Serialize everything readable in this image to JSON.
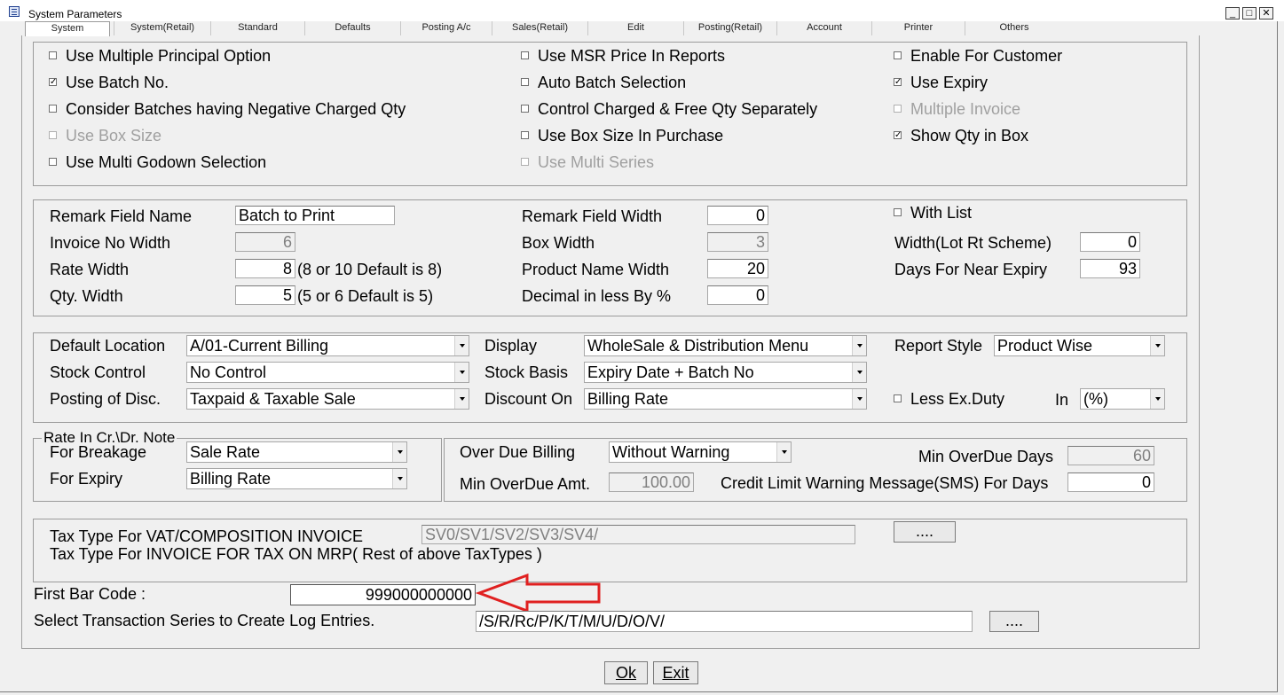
{
  "window": {
    "title": "System Parameters",
    "icon": "app-menu-icon"
  },
  "tabs": [
    {
      "label": "System",
      "active": true
    },
    {
      "label": "System(Retail)"
    },
    {
      "label": "Standard"
    },
    {
      "label": "Defaults"
    },
    {
      "label": "Posting A/c"
    },
    {
      "label": "Sales(Retail)"
    },
    {
      "label": "Edit"
    },
    {
      "label": "Posting(Retail)"
    },
    {
      "label": "Account"
    },
    {
      "label": "Printer"
    },
    {
      "label": "Others"
    }
  ],
  "options": [
    {
      "label": "Use Multiple Principal Option",
      "checked": false,
      "enabled": true
    },
    {
      "label": "Use Batch No.",
      "checked": true,
      "enabled": true
    },
    {
      "label": "Consider Batches having Negative Charged Qty",
      "checked": false,
      "enabled": true
    },
    {
      "label": "Use Box Size",
      "checked": false,
      "enabled": false
    },
    {
      "label": "Use Multi Godown Selection",
      "checked": false,
      "enabled": true
    },
    {
      "label": "Use MSR  Price In Reports",
      "checked": false,
      "enabled": true
    },
    {
      "label": "Auto Batch Selection",
      "checked": false,
      "enabled": true
    },
    {
      "label": "Control Charged & Free Qty Separately",
      "checked": false,
      "enabled": true
    },
    {
      "label": "Use Box Size In Purchase",
      "checked": false,
      "enabled": true
    },
    {
      "label": "Use Multi Series",
      "checked": false,
      "enabled": false
    },
    {
      "label": "Enable For Customer",
      "checked": false,
      "enabled": true
    },
    {
      "label": "Use Expiry",
      "checked": true,
      "enabled": true
    },
    {
      "label": "Multiple Invoice",
      "checked": false,
      "enabled": false
    },
    {
      "label": "Show Qty in Box",
      "checked": true,
      "enabled": true
    }
  ],
  "fields": {
    "remark_field_name": {
      "label": "Remark Field Name",
      "value": "Batch to Print"
    },
    "invoice_no_width": {
      "label": "Invoice No Width",
      "value": "6"
    },
    "rate_width": {
      "label": "Rate Width",
      "value": "8",
      "hint": "(8 or 10 Default is 8)"
    },
    "qty_width": {
      "label": "Qty. Width",
      "value": "5",
      "hint": "(5 or 6 Default is 5)"
    },
    "remark_field_width": {
      "label": "Remark Field Width",
      "value": "0"
    },
    "box_width": {
      "label": "Box Width",
      "value": "3"
    },
    "product_name_width": {
      "label": "Product Name Width",
      "value": "20"
    },
    "decimal_less": {
      "label": "Decimal in less By %",
      "value": "0"
    },
    "with_list": {
      "label": "With List",
      "checked": false
    },
    "lot_rt_scheme_width": {
      "label": "Width(Lot Rt Scheme)",
      "value": "0"
    },
    "days_near_expiry": {
      "label": "Days For Near Expiry",
      "value": "93"
    }
  },
  "combos": {
    "default_location": {
      "label": "Default Location",
      "value": "A/01-Current Billing"
    },
    "stock_control": {
      "label": "Stock Control",
      "value": "No Control"
    },
    "posting_disc": {
      "label": "Posting of Disc.",
      "value": "Taxpaid & Taxable Sale"
    },
    "display": {
      "label": "Display",
      "value": "WholeSale & Distribution Menu"
    },
    "stock_basis": {
      "label": "Stock Basis",
      "value": "Expiry Date + Batch No"
    },
    "discount_on": {
      "label": "Discount On",
      "value": "Billing Rate"
    },
    "report_style": {
      "label": "Report Style",
      "value": "Product Wise"
    },
    "less_ex_duty": {
      "label": "Less Ex.Duty",
      "checked": false
    },
    "in_unit": {
      "label": "In",
      "value": "(%)"
    }
  },
  "rate_note": {
    "legend": "Rate In Cr.\\Dr. Note",
    "breakage": {
      "label": "For Breakage",
      "value": "Sale Rate"
    },
    "expiry": {
      "label": "For Expiry",
      "value": "Billing Rate"
    }
  },
  "overdue": {
    "billing": {
      "label": "Over Due Billing",
      "value": "Without Warning"
    },
    "min_amt": {
      "label": "Min OverDue Amt.",
      "value": "100.00"
    },
    "min_days": {
      "label": "Min OverDue Days",
      "value": "60"
    },
    "credit_sms": {
      "label": "Credit Limit Warning Message(SMS) For Days",
      "value": "0"
    }
  },
  "tax": {
    "vat_label": "Tax Type For VAT/COMPOSITION INVOICE",
    "vat_value": "SV0/SV1/SV2/SV3/SV4/",
    "mrp_label": "Tax Type For INVOICE FOR TAX ON MRP( Rest of above TaxTypes )",
    "browse": "...."
  },
  "bar_code": {
    "label": "First Bar Code :",
    "value": "999000000000",
    "arrow_color": "#e02020"
  },
  "log_series": {
    "label": "Select Transaction Series to Create Log Entries.",
    "value": "/S/R/Rc/P/K/T/M/U/D/O/V/",
    "browse": "...."
  },
  "buttons": {
    "ok": "Ok",
    "exit": "Exit"
  }
}
